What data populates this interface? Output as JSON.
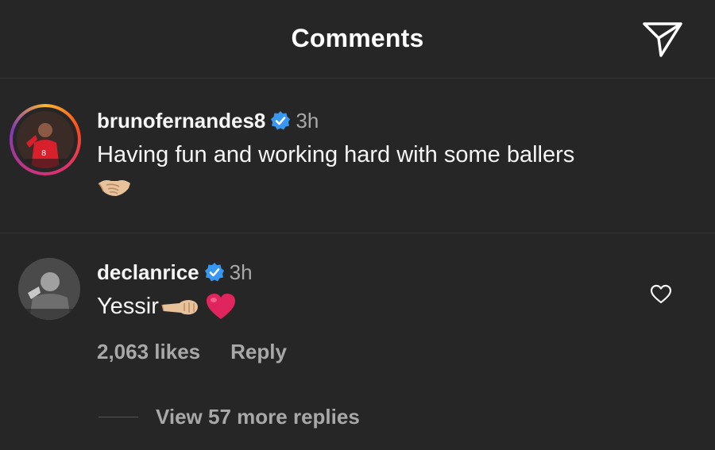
{
  "header": {
    "title": "Comments"
  },
  "caption": {
    "username": "brunofernandes8",
    "time": "3h",
    "text": "Having fun and working hard with some ballers"
  },
  "reply": {
    "username": "declanrice",
    "time": "3h",
    "text": "Yessir",
    "likes": "2,063 likes",
    "reply_label": "Reply",
    "view_more": "View 57 more replies"
  },
  "colors": {
    "background": "#262626",
    "verified": "#3897f0",
    "muted_text": "#a8a8a8",
    "heart": "#e0245e"
  },
  "icons": {
    "header_action": "send-icon",
    "verified": "verified-badge-icon",
    "like": "heart-outline-icon"
  }
}
